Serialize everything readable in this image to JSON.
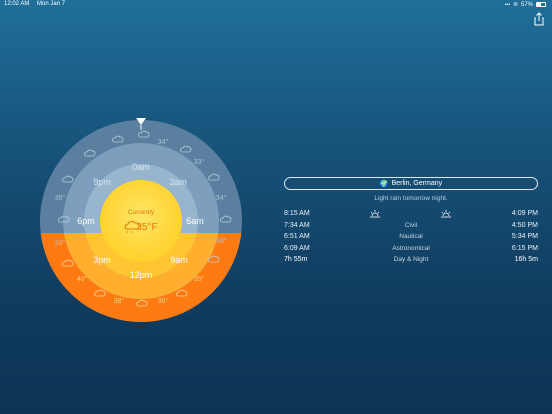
{
  "status": {
    "time": "12:02 AM",
    "date": "Mon Jan 7",
    "battery": "57%"
  },
  "dial": {
    "currently_label": "Currently",
    "current_temp": "35°F",
    "hour_labels": {
      "top": "0am",
      "upper_right": "3am",
      "right": "6am",
      "lower_right": "9am",
      "bottom": "12pm",
      "lower_left": "3pm",
      "left": "6pm",
      "upper_left": "9pm"
    },
    "outer_temps": [
      "34°",
      "33°",
      "34°",
      "34°",
      "35°",
      "36°",
      "38°",
      "40°",
      "38°",
      "35°"
    ],
    "colors": {
      "night": "#6d8fae",
      "day": "#ff8a1c",
      "core": "#ffd83a"
    }
  },
  "info": {
    "location": "Berlin, Germany",
    "forecast": "Light rain tomorrow night.",
    "rows": [
      {
        "left": "8:15 AM",
        "center": "",
        "right": "4:09 PM",
        "icons": true
      },
      {
        "left": "7:34 AM",
        "center": "Civil",
        "right": "4:50 PM"
      },
      {
        "left": "6:51 AM",
        "center": "Nautical",
        "right": "5:34 PM"
      },
      {
        "left": "6:09 AM",
        "center": "Astronomical",
        "right": "6:15 PM"
      },
      {
        "left": "7h 55m",
        "center": "Day & Night",
        "right": "16h 5m"
      }
    ]
  }
}
